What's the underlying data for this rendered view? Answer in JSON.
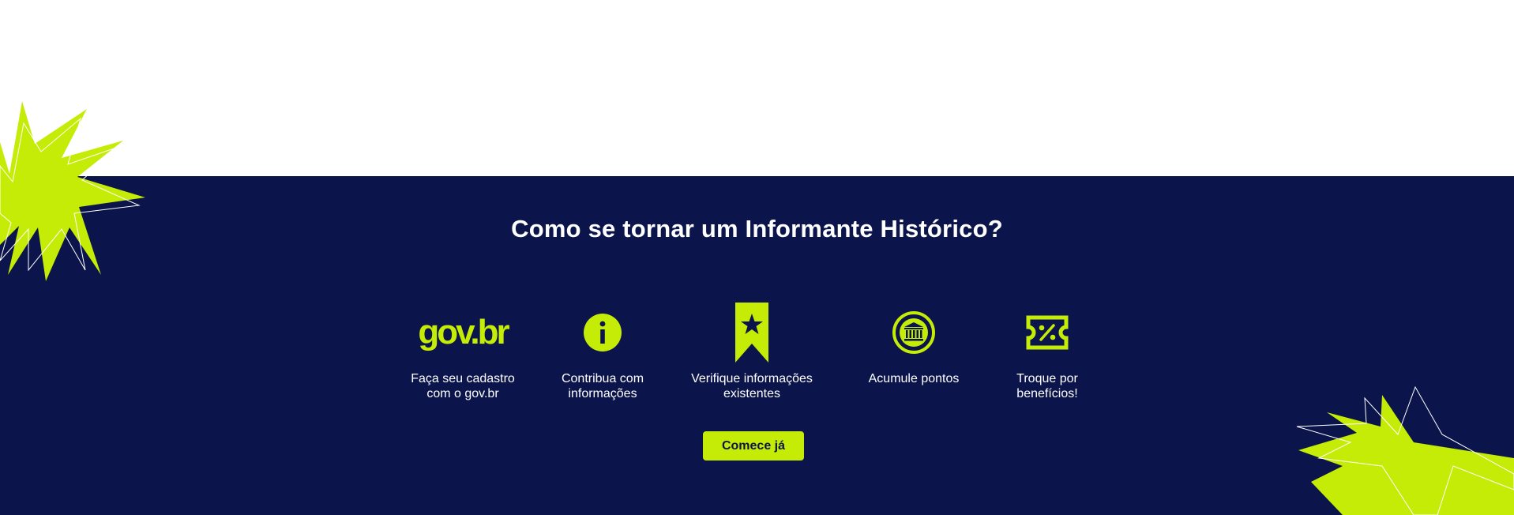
{
  "section": {
    "title": "Como se tornar um Informante Histórico?",
    "cta_label": "Comece já"
  },
  "steps": [
    {
      "icon": "govbr-logo",
      "logo_text": "gov.br",
      "label": "Faça seu cadastro\ncom o gov.br"
    },
    {
      "icon": "info-icon",
      "label": "Contribua com\ninformações"
    },
    {
      "icon": "bookmark-star-icon",
      "label": "Verifique informações\nexistentes"
    },
    {
      "icon": "museum-badge-icon",
      "label": "Acumule pontos"
    },
    {
      "icon": "discount-ticket-icon",
      "label": "Troque por\nbenefícios!"
    }
  ],
  "colors": {
    "navy": "#0b154b",
    "accent": "#c5ec06",
    "text": "#ffffff"
  }
}
